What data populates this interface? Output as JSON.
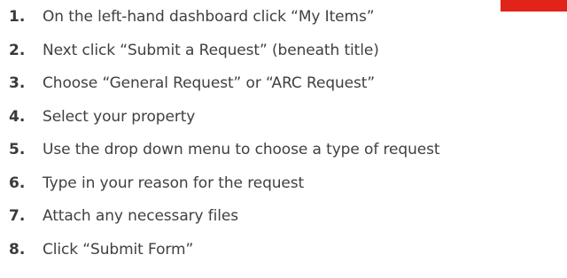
{
  "accent_color": "#e2231a",
  "text_color": "#404040",
  "steps": [
    {
      "number": "1.",
      "text": "On the left-hand dashboard click “My Items”"
    },
    {
      "number": "2.",
      "text": "Next click “Submit a Request” (beneath title)"
    },
    {
      "number": "3.",
      "text": "Choose “General Request” or “ARC Request”"
    },
    {
      "number": "4.",
      "text": "Select your property"
    },
    {
      "number": "5.",
      "text": "Use the drop down menu to choose a type of request"
    },
    {
      "number": "6.",
      "text": "Type in your reason for the request"
    },
    {
      "number": "7.",
      "text": "Attach any necessary files"
    },
    {
      "number": "8.",
      "text": "Click “Submit Form”"
    }
  ]
}
